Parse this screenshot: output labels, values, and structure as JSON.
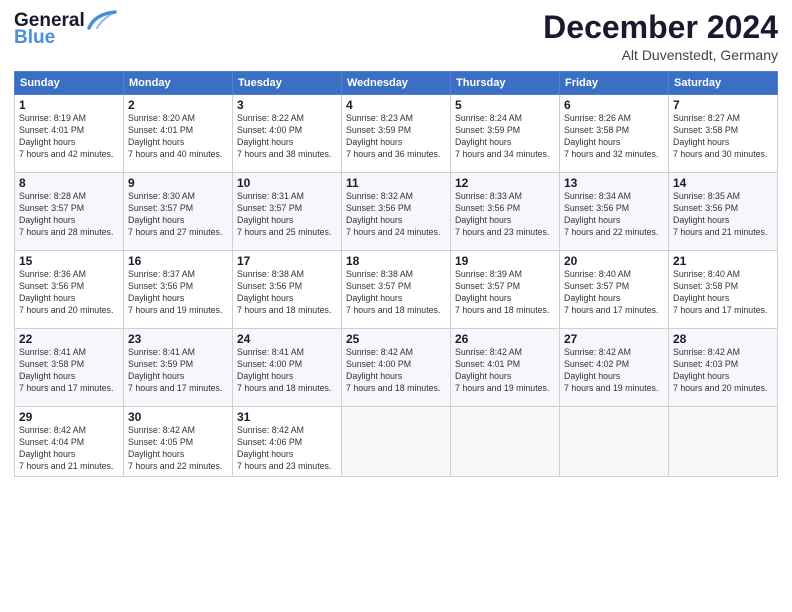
{
  "header": {
    "logo_general": "General",
    "logo_blue": "Blue",
    "month_title": "December 2024",
    "location": "Alt Duvenstedt, Germany"
  },
  "weekdays": [
    "Sunday",
    "Monday",
    "Tuesday",
    "Wednesday",
    "Thursday",
    "Friday",
    "Saturday"
  ],
  "weeks": [
    [
      {
        "day": "1",
        "sunrise": "8:19 AM",
        "sunset": "4:01 PM",
        "daylight": "7 hours and 42 minutes."
      },
      {
        "day": "2",
        "sunrise": "8:20 AM",
        "sunset": "4:01 PM",
        "daylight": "7 hours and 40 minutes."
      },
      {
        "day": "3",
        "sunrise": "8:22 AM",
        "sunset": "4:00 PM",
        "daylight": "7 hours and 38 minutes."
      },
      {
        "day": "4",
        "sunrise": "8:23 AM",
        "sunset": "3:59 PM",
        "daylight": "7 hours and 36 minutes."
      },
      {
        "day": "5",
        "sunrise": "8:24 AM",
        "sunset": "3:59 PM",
        "daylight": "7 hours and 34 minutes."
      },
      {
        "day": "6",
        "sunrise": "8:26 AM",
        "sunset": "3:58 PM",
        "daylight": "7 hours and 32 minutes."
      },
      {
        "day": "7",
        "sunrise": "8:27 AM",
        "sunset": "3:58 PM",
        "daylight": "7 hours and 30 minutes."
      }
    ],
    [
      {
        "day": "8",
        "sunrise": "8:28 AM",
        "sunset": "3:57 PM",
        "daylight": "7 hours and 28 minutes."
      },
      {
        "day": "9",
        "sunrise": "8:30 AM",
        "sunset": "3:57 PM",
        "daylight": "7 hours and 27 minutes."
      },
      {
        "day": "10",
        "sunrise": "8:31 AM",
        "sunset": "3:57 PM",
        "daylight": "7 hours and 25 minutes."
      },
      {
        "day": "11",
        "sunrise": "8:32 AM",
        "sunset": "3:56 PM",
        "daylight": "7 hours and 24 minutes."
      },
      {
        "day": "12",
        "sunrise": "8:33 AM",
        "sunset": "3:56 PM",
        "daylight": "7 hours and 23 minutes."
      },
      {
        "day": "13",
        "sunrise": "8:34 AM",
        "sunset": "3:56 PM",
        "daylight": "7 hours and 22 minutes."
      },
      {
        "day": "14",
        "sunrise": "8:35 AM",
        "sunset": "3:56 PM",
        "daylight": "7 hours and 21 minutes."
      }
    ],
    [
      {
        "day": "15",
        "sunrise": "8:36 AM",
        "sunset": "3:56 PM",
        "daylight": "7 hours and 20 minutes."
      },
      {
        "day": "16",
        "sunrise": "8:37 AM",
        "sunset": "3:56 PM",
        "daylight": "7 hours and 19 minutes."
      },
      {
        "day": "17",
        "sunrise": "8:38 AM",
        "sunset": "3:56 PM",
        "daylight": "7 hours and 18 minutes."
      },
      {
        "day": "18",
        "sunrise": "8:38 AM",
        "sunset": "3:57 PM",
        "daylight": "7 hours and 18 minutes."
      },
      {
        "day": "19",
        "sunrise": "8:39 AM",
        "sunset": "3:57 PM",
        "daylight": "7 hours and 18 minutes."
      },
      {
        "day": "20",
        "sunrise": "8:40 AM",
        "sunset": "3:57 PM",
        "daylight": "7 hours and 17 minutes."
      },
      {
        "day": "21",
        "sunrise": "8:40 AM",
        "sunset": "3:58 PM",
        "daylight": "7 hours and 17 minutes."
      }
    ],
    [
      {
        "day": "22",
        "sunrise": "8:41 AM",
        "sunset": "3:58 PM",
        "daylight": "7 hours and 17 minutes."
      },
      {
        "day": "23",
        "sunrise": "8:41 AM",
        "sunset": "3:59 PM",
        "daylight": "7 hours and 17 minutes."
      },
      {
        "day": "24",
        "sunrise": "8:41 AM",
        "sunset": "4:00 PM",
        "daylight": "7 hours and 18 minutes."
      },
      {
        "day": "25",
        "sunrise": "8:42 AM",
        "sunset": "4:00 PM",
        "daylight": "7 hours and 18 minutes."
      },
      {
        "day": "26",
        "sunrise": "8:42 AM",
        "sunset": "4:01 PM",
        "daylight": "7 hours and 19 minutes."
      },
      {
        "day": "27",
        "sunrise": "8:42 AM",
        "sunset": "4:02 PM",
        "daylight": "7 hours and 19 minutes."
      },
      {
        "day": "28",
        "sunrise": "8:42 AM",
        "sunset": "4:03 PM",
        "daylight": "7 hours and 20 minutes."
      }
    ],
    [
      {
        "day": "29",
        "sunrise": "8:42 AM",
        "sunset": "4:04 PM",
        "daylight": "7 hours and 21 minutes."
      },
      {
        "day": "30",
        "sunrise": "8:42 AM",
        "sunset": "4:05 PM",
        "daylight": "7 hours and 22 minutes."
      },
      {
        "day": "31",
        "sunrise": "8:42 AM",
        "sunset": "4:06 PM",
        "daylight": "7 hours and 23 minutes."
      },
      null,
      null,
      null,
      null
    ]
  ]
}
